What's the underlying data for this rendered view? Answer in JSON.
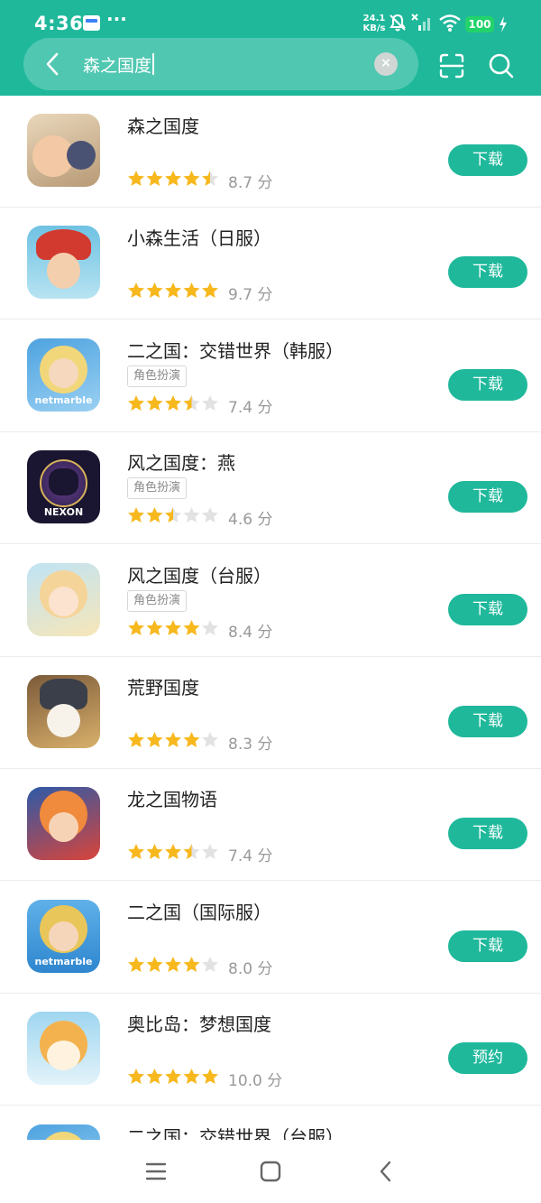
{
  "status_bar": {
    "time": "4:36",
    "dots": "···",
    "net_speed_value": "24.1",
    "net_speed_unit": "KB/s",
    "battery": "100",
    "icons": [
      "calendar-notification-icon",
      "mute-icon",
      "no-signal-icon",
      "signal-icon",
      "wifi-icon",
      "battery-icon",
      "charging-icon"
    ]
  },
  "search": {
    "query": "森之国度",
    "icons": [
      "back-arrow-icon",
      "clear-icon",
      "scan-icon",
      "search-icon"
    ]
  },
  "colors": {
    "accent": "#1fb89b",
    "star_filled": "#f7b81e",
    "star_empty": "#e2e2e2"
  },
  "results": [
    {
      "title": "森之国度",
      "tag": "",
      "stars": 4.5,
      "score": "8.7 分",
      "button": "下载"
    },
    {
      "title": "小森生活（日服）",
      "tag": "",
      "stars": 5,
      "score": "9.7 分",
      "button": "下载"
    },
    {
      "title": "二之国：交错世界（韩服）",
      "tag": "角色扮演",
      "stars": 3.5,
      "score": "7.4 分",
      "button": "下载"
    },
    {
      "title": "风之国度：燕",
      "tag": "角色扮演",
      "stars": 2.5,
      "score": "4.6 分",
      "button": "下载"
    },
    {
      "title": "风之国度（台服）",
      "tag": "角色扮演",
      "stars": 4,
      "score": "8.4 分",
      "button": "下载"
    },
    {
      "title": "荒野国度",
      "tag": "",
      "stars": 4,
      "score": "8.3 分",
      "button": "下载"
    },
    {
      "title": "龙之国物语",
      "tag": "",
      "stars": 3.5,
      "score": "7.4 分",
      "button": "下载"
    },
    {
      "title": "二之国（国际服）",
      "tag": "",
      "stars": 4,
      "score": "8.0 分",
      "button": "下载"
    },
    {
      "title": "奥比岛：梦想国度",
      "tag": "",
      "stars": 5,
      "score": "10.0 分",
      "button": "预约"
    },
    {
      "title": "二之国：交错世界（台服）",
      "tag": "",
      "stars": 0,
      "score": "",
      "button": ""
    }
  ],
  "icon_labels": {
    "netmarble": "netmarble",
    "nexon": "NEXON"
  },
  "nav": [
    "menu-icon",
    "home-icon",
    "back-icon"
  ]
}
